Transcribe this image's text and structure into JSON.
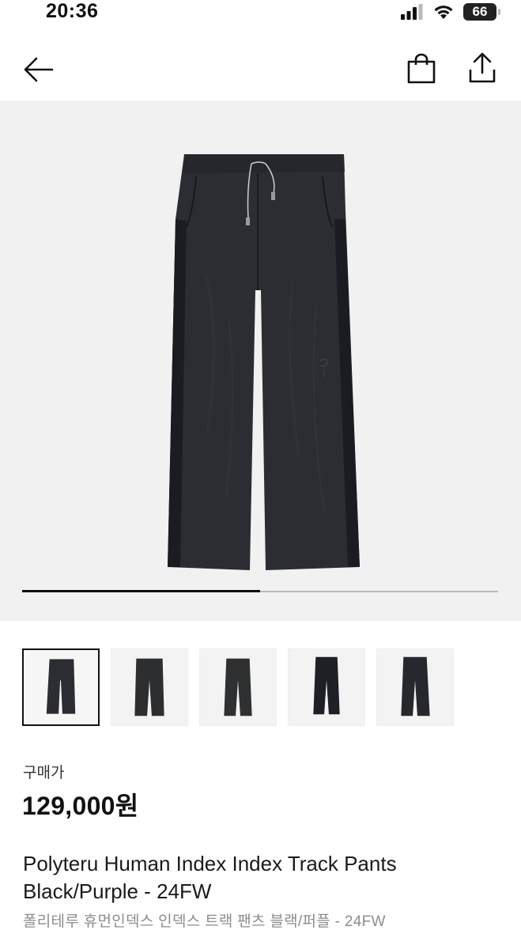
{
  "status_bar": {
    "time": "20:36",
    "battery": "66",
    "icons": [
      "signal-icon",
      "wifi-icon",
      "battery-icon"
    ]
  },
  "nav": {
    "back_icon": "arrow-left-icon",
    "bag_icon": "shopping-bag-icon",
    "share_icon": "share-icon"
  },
  "gallery": {
    "image_index": 1,
    "image_count": 2,
    "progress": 0.5,
    "thumbnails": [
      {
        "name": "thumb-front",
        "selected": true
      },
      {
        "name": "thumb-angle-1",
        "selected": false
      },
      {
        "name": "thumb-angle-2",
        "selected": false
      },
      {
        "name": "thumb-angle-3",
        "selected": false
      },
      {
        "name": "thumb-angle-4",
        "selected": false
      }
    ]
  },
  "product": {
    "price_label": "구매가",
    "price": "129,000원",
    "name_en_line1": "Polyteru Human Index Index Track Pants",
    "name_en_line2": "Black/Purple - 24FW",
    "name_ko": "폴리테루 휴먼인덱스 인덱스 트랙 팬츠 블랙/퍼플 - 24FW"
  },
  "colors": {
    "pants": "#2b2d33",
    "pants_shadow": "#1e2025",
    "background": "#f1f1f1",
    "accent": "#111111"
  }
}
